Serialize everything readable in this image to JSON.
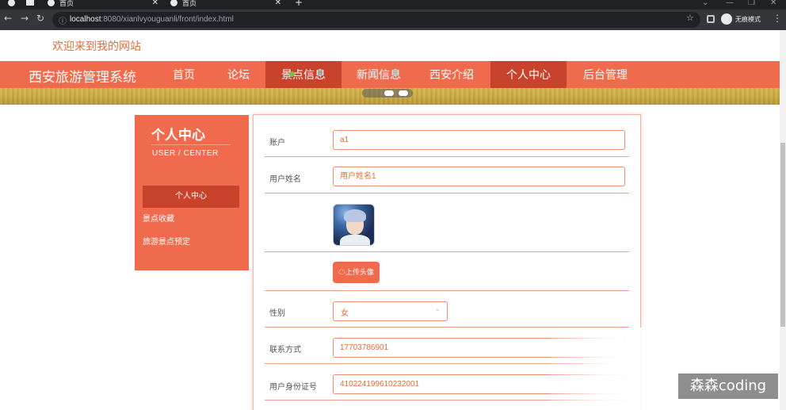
{
  "browser": {
    "tabs": [
      {
        "label": ""
      },
      {
        "label": "首页"
      },
      {
        "label": "首页"
      }
    ],
    "url_host": "localhost",
    "url_rest": ":8080/xianlvyouguanli/front/index.html",
    "profile_label": "无痕模式"
  },
  "site": {
    "welcome": "欢迎来到我的网站",
    "brand": "西安旅游管理系统",
    "nav": [
      {
        "label": "首页"
      },
      {
        "label": "论坛"
      },
      {
        "label": "景点信息"
      },
      {
        "label": "新闻信息"
      },
      {
        "label": "西安介绍"
      },
      {
        "label": "个人中心"
      },
      {
        "label": "后台管理"
      }
    ]
  },
  "sidebar": {
    "title": "个人中心",
    "subtitle": "USER / CENTER",
    "items": [
      {
        "label": "个人中心"
      },
      {
        "label": "景点收藏"
      },
      {
        "label": "旅游景点预定"
      }
    ]
  },
  "form": {
    "account_label": "账户",
    "account_value": "a1",
    "name_label": "用户姓名",
    "name_value": "用户姓名1",
    "upload_label": "上传头像",
    "gender_label": "性别",
    "gender_value": "女",
    "phone_label": "联系方式",
    "phone_value": "17703786901",
    "idcard_label": "用户身份证号",
    "idcard_value": "410224199610232001"
  },
  "watermark": "森森coding",
  "colors": {
    "accent": "#f06b4d",
    "accent_dark": "#c9432c",
    "welcome_text": "#e36e3a"
  }
}
